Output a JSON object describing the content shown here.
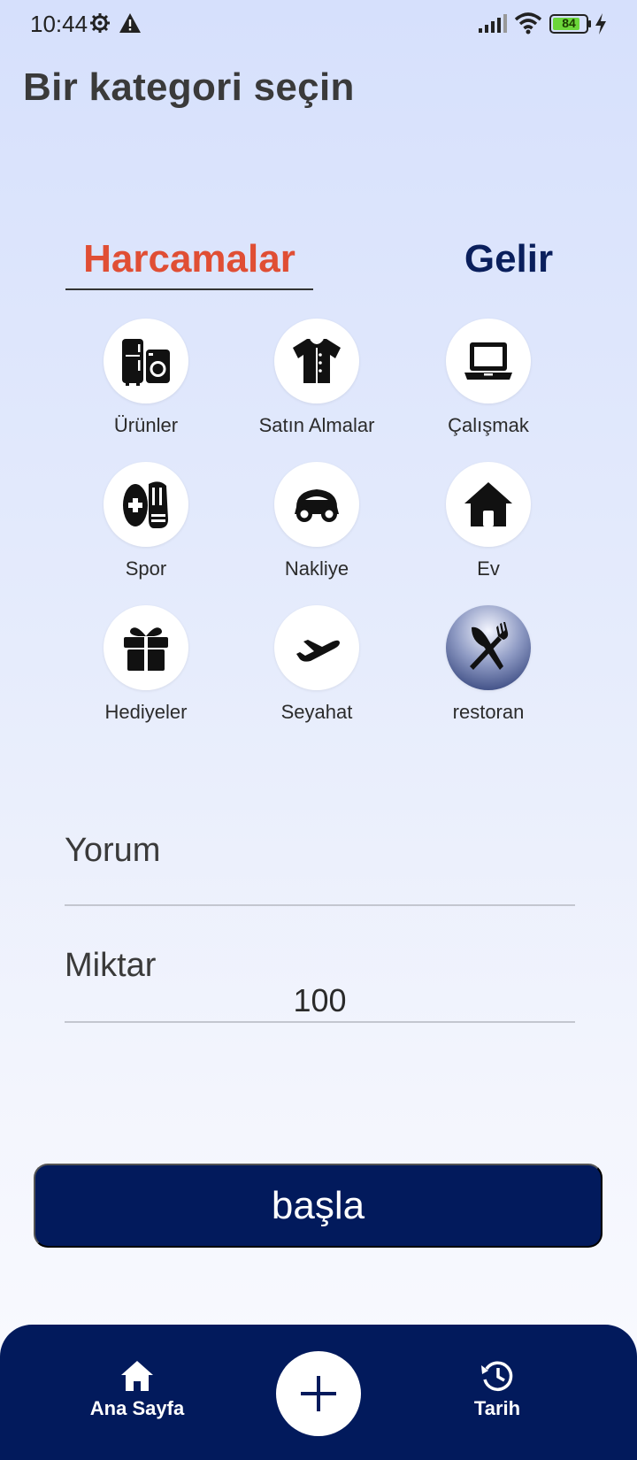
{
  "status_bar": {
    "time": "10:44",
    "battery": "84",
    "icons": [
      "settings-gear-icon",
      "warning-icon",
      "signal-icon",
      "wifi-icon",
      "battery-icon",
      "charging-bolt-icon"
    ]
  },
  "title": "Bir kategori seçin",
  "tabs": {
    "expense": "Harcamalar",
    "income": "Gelir",
    "active": "expense",
    "active_color": "#e04e34",
    "inactive_color": "#0a1f5c"
  },
  "categories": [
    {
      "label": "Ürünler",
      "icon": "appliances-icon",
      "selected": false
    },
    {
      "label": "Satın Almalar",
      "icon": "shirt-icon",
      "selected": false
    },
    {
      "label": "Çalışmak",
      "icon": "laptop-icon",
      "selected": false
    },
    {
      "label": "Spor",
      "icon": "shoes-icon",
      "selected": false
    },
    {
      "label": "Nakliye",
      "icon": "car-icon",
      "selected": false
    },
    {
      "label": "Ev",
      "icon": "house-icon",
      "selected": false
    },
    {
      "label": "Hediyeler",
      "icon": "gift-icon",
      "selected": false
    },
    {
      "label": "Seyahat",
      "icon": "airplane-icon",
      "selected": false
    },
    {
      "label": "restoran",
      "icon": "utensils-icon",
      "selected": true
    }
  ],
  "form": {
    "comment_label": "Yorum",
    "comment_value": "",
    "amount_label": "Miktar",
    "amount_value": "100"
  },
  "start_button": "başla",
  "bottom_nav": {
    "home": "Ana Sayfa",
    "history": "Tarih",
    "add_icon": "plus-icon"
  },
  "colors": {
    "primary": "#021a5c",
    "accent": "#e04e34",
    "background_top": "#d6e0fc",
    "background_bottom": "#fafbff"
  }
}
